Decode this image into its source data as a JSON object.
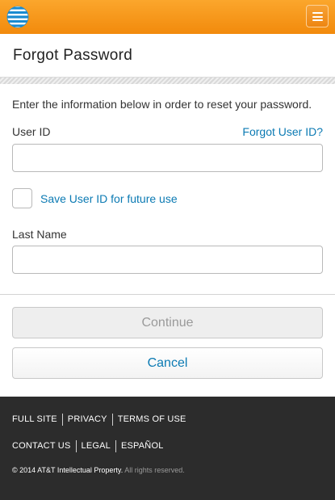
{
  "header": {
    "logo_icon": "att-globe-icon",
    "menu_icon": "hamburger-menu-icon",
    "background": "#f5961f"
  },
  "page": {
    "title": "Forgot Password"
  },
  "form": {
    "instructions": "Enter the information below in order to reset your password.",
    "user_id_label": "User ID",
    "forgot_user_id_link": "Forgot User ID?",
    "user_id_value": "",
    "save_user_id_label": "Save User ID for future use",
    "save_user_id_checked": false,
    "last_name_label": "Last Name",
    "last_name_value": ""
  },
  "buttons": {
    "continue_label": "Continue",
    "cancel_label": "Cancel"
  },
  "colors": {
    "link": "#0b7ab3",
    "footer_bg": "#2c2c2c"
  },
  "footer": {
    "links_row1": [
      "FULL SITE",
      "PRIVACY",
      "TERMS OF USE"
    ],
    "links_row2": [
      "CONTACT US",
      "LEGAL",
      "ESPAÑOL"
    ],
    "copyright": "© 2014 AT&T Intellectual Property.",
    "rights": "All rights reserved."
  }
}
